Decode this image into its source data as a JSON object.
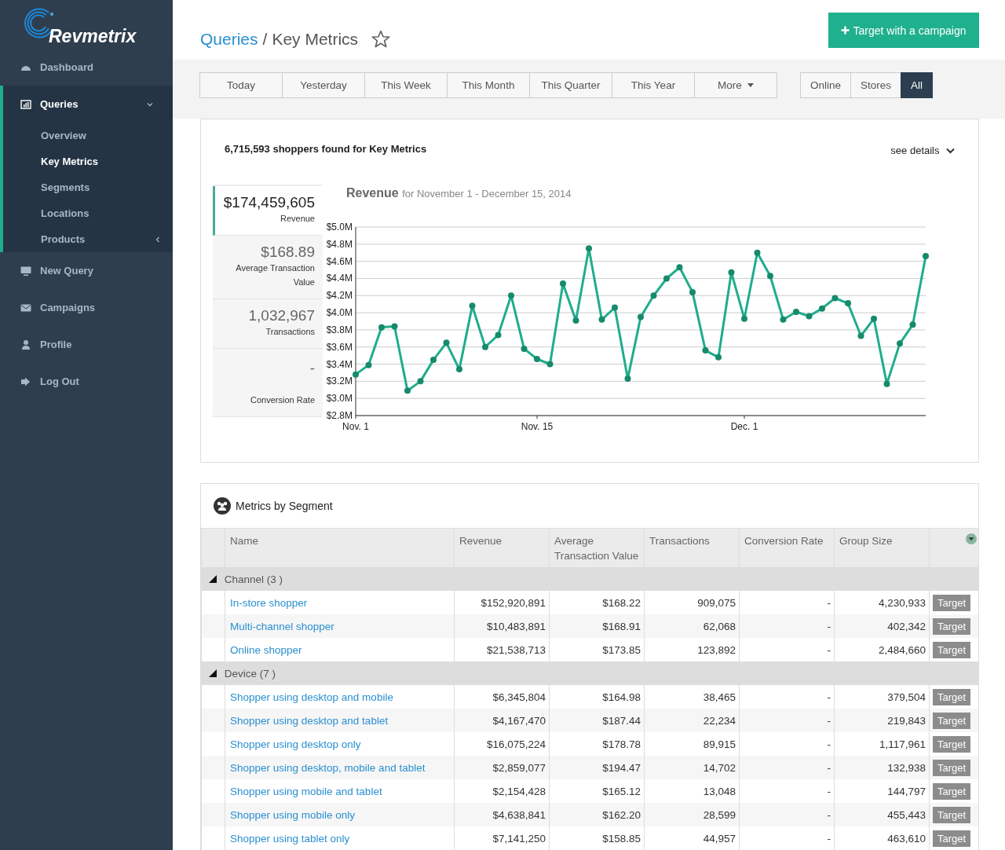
{
  "sidebar": {
    "logo": "Revmetrix",
    "items": [
      {
        "label": "Dashboard",
        "selected": false
      },
      {
        "label": "Queries",
        "selected": true,
        "expanded": true,
        "children": [
          {
            "label": "Overview",
            "selected": false,
            "kind": "link"
          },
          {
            "label": "Key Metrics",
            "selected": true,
            "kind": "link"
          },
          {
            "label": "Segments",
            "selected": false,
            "kind": "link"
          },
          {
            "label": "Locations",
            "selected": false,
            "kind": "link"
          },
          {
            "label": "Products",
            "selected": false,
            "kind": "submenu"
          }
        ]
      },
      {
        "label": "New Query",
        "selected": false
      },
      {
        "label": "Campaigns",
        "selected": false
      },
      {
        "label": "Profile",
        "selected": false
      },
      {
        "label": "Log Out",
        "selected": false
      }
    ]
  },
  "header": {
    "breadcrumb": [
      {
        "label": "Queries",
        "kind": "link"
      },
      {
        "label": "Key Metrics",
        "kind": "current"
      }
    ],
    "separator": "/",
    "starred": false,
    "action": "Target with a campaign"
  },
  "date_filters": [
    {
      "label": "Today",
      "selected": false,
      "kind": "option"
    },
    {
      "label": "Yesterday",
      "selected": false,
      "kind": "option"
    },
    {
      "label": "This Week",
      "selected": false,
      "kind": "option"
    },
    {
      "label": "This Month",
      "selected": false,
      "kind": "option"
    },
    {
      "label": "This Quarter",
      "selected": false,
      "kind": "option"
    },
    {
      "label": "This Year",
      "selected": false,
      "kind": "option"
    },
    {
      "label": "More",
      "selected": false,
      "kind": "dropdown"
    }
  ],
  "channel_filters": [
    {
      "label": "Online",
      "selected": false
    },
    {
      "label": "Stores",
      "selected": false
    },
    {
      "label": "All",
      "selected": true
    }
  ],
  "summary": {
    "text": "6,715,593 shoppers found for Key Metrics",
    "details_link": "see details"
  },
  "metrics": [
    {
      "value": "$174,459,605",
      "label": "Revenue",
      "selected": true
    },
    {
      "value": "$168.89",
      "label": "Average Transaction Value",
      "selected": false
    },
    {
      "value": "1,032,967",
      "label": "Transactions",
      "selected": false
    },
    {
      "value": "-",
      "label": "Conversion Rate",
      "selected": false
    }
  ],
  "revenue_chart": {
    "subtitle": "for November 1 - December 15, 2014",
    "chart_data": {
      "type": "line",
      "title": "Revenue",
      "grid": true,
      "categories": [
        "Nov. 1",
        null,
        null,
        null,
        null,
        null,
        null,
        null,
        null,
        null,
        null,
        null,
        null,
        null,
        "Nov. 15",
        null,
        null,
        null,
        null,
        null,
        null,
        null,
        null,
        null,
        null,
        null,
        null,
        null,
        null,
        null,
        "Dec. 1",
        null,
        null,
        null,
        null,
        null,
        null,
        null,
        null,
        null,
        null,
        null,
        null,
        null,
        null
      ],
      "series": [
        {
          "color": "#1fad8c",
          "marker": true,
          "values": [
            3.28,
            3.39,
            3.83,
            3.84,
            3.09,
            3.2,
            3.45,
            3.65,
            3.34,
            4.08,
            3.6,
            3.74,
            4.2,
            3.58,
            3.46,
            3.4,
            4.34,
            3.91,
            4.75,
            3.92,
            4.06,
            3.23,
            3.95,
            4.2,
            4.4,
            4.53,
            4.24,
            3.56,
            3.48,
            4.47,
            3.93,
            4.7,
            4.43,
            3.92,
            4.01,
            3.96,
            4.05,
            4.17,
            4.11,
            3.73,
            3.93,
            3.17,
            3.64,
            3.86,
            4.66
          ]
        }
      ],
      "ylim": [
        2.8,
        5.0
      ],
      "yticks": [
        {
          "value": 2.8,
          "label": "$2.8M"
        },
        {
          "value": 3.0,
          "label": "$3.0M"
        },
        {
          "value": 3.2,
          "label": "$3.2M"
        },
        {
          "value": 3.4,
          "label": "$3.4M"
        },
        {
          "value": 3.6,
          "label": "$3.6M"
        },
        {
          "value": 3.8,
          "label": "$3.8M"
        },
        {
          "value": 4.0,
          "label": "$4.0M"
        },
        {
          "value": 4.2,
          "label": "$4.2M"
        },
        {
          "value": 4.4,
          "label": "$4.4M"
        },
        {
          "value": 4.6,
          "label": "$4.6M"
        },
        {
          "value": 4.8,
          "label": "$4.8M"
        },
        {
          "value": 5.0,
          "label": "$5.0M"
        }
      ]
    }
  },
  "segments_table": {
    "title": "Metrics by Segment",
    "columns": [
      "Name",
      "Revenue",
      "Average Transaction Value",
      "Transactions",
      "Conversion Rate",
      "Group Size"
    ],
    "groups": [
      {
        "label": "Channel (3 )",
        "expanded": true,
        "rows": [
          {
            "name": "In-store shopper",
            "revenue": "$152,920,891",
            "avg_value": "$168.22",
            "transactions": "909,075",
            "conversion": "-",
            "group_size": "4,230,933",
            "action": "Target"
          },
          {
            "name": "Multi-channel shopper",
            "revenue": "$10,483,891",
            "avg_value": "$168.91",
            "transactions": "62,068",
            "conversion": "-",
            "group_size": "402,342",
            "action": "Target"
          },
          {
            "name": "Online shopper",
            "revenue": "$21,538,713",
            "avg_value": "$173.85",
            "transactions": "123,892",
            "conversion": "-",
            "group_size": "2,484,660",
            "action": "Target"
          }
        ]
      },
      {
        "label": "Device (7 )",
        "expanded": true,
        "rows": [
          {
            "name": "Shopper using desktop and mobile",
            "revenue": "$6,345,804",
            "avg_value": "$164.98",
            "transactions": "38,465",
            "conversion": "-",
            "group_size": "379,504",
            "action": "Target"
          },
          {
            "name": "Shopper using desktop and tablet",
            "revenue": "$4,167,470",
            "avg_value": "$187.44",
            "transactions": "22,234",
            "conversion": "-",
            "group_size": "219,843",
            "action": "Target"
          },
          {
            "name": "Shopper using desktop only",
            "revenue": "$16,075,224",
            "avg_value": "$178.78",
            "transactions": "89,915",
            "conversion": "-",
            "group_size": "1,117,961",
            "action": "Target"
          },
          {
            "name": "Shopper using desktop, mobile and tablet",
            "revenue": "$2,859,077",
            "avg_value": "$194.47",
            "transactions": "14,702",
            "conversion": "-",
            "group_size": "132,938",
            "action": "Target"
          },
          {
            "name": "Shopper using mobile and tablet",
            "revenue": "$2,154,428",
            "avg_value": "$165.12",
            "transactions": "13,048",
            "conversion": "-",
            "group_size": "144,797",
            "action": "Target"
          },
          {
            "name": "Shopper using mobile only",
            "revenue": "$4,638,841",
            "avg_value": "$162.20",
            "transactions": "28,599",
            "conversion": "-",
            "group_size": "455,443",
            "action": "Target"
          },
          {
            "name": "Shopper using tablet only",
            "revenue": "$7,141,250",
            "avg_value": "$158.85",
            "transactions": "44,957",
            "conversion": "-",
            "group_size": "463,610",
            "action": "Target"
          }
        ]
      }
    ]
  }
}
